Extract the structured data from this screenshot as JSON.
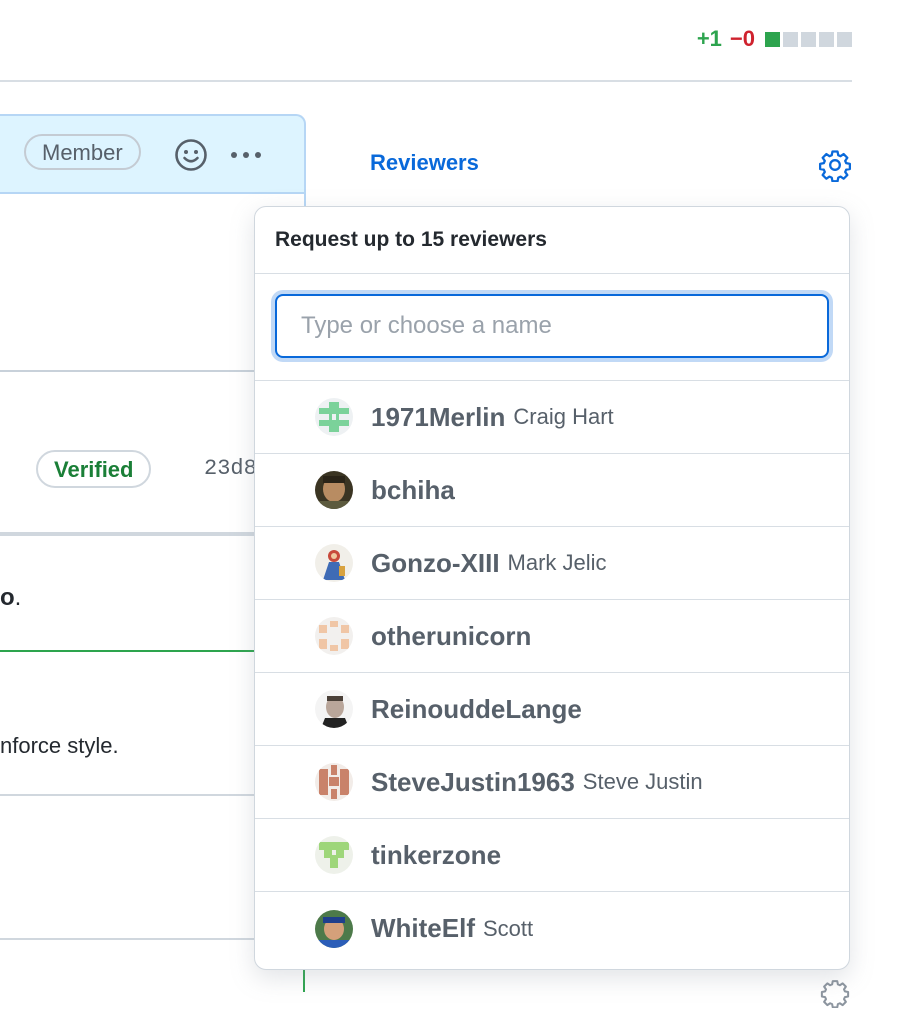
{
  "diffstat": {
    "additions": "+1",
    "deletions": "−0"
  },
  "comment": {
    "role_badge": "Member",
    "smiley_icon": "smiley-icon",
    "more_icon": "kebab-horizontal-icon"
  },
  "commit": {
    "verified_label": "Verified",
    "sha_fragment": "23d8"
  },
  "body_fragments": {
    "bold_fragment": "o",
    "period": ".",
    "enforce_text": "nforce style."
  },
  "sidebar": {
    "reviewers_label": "Reviewers",
    "gear_icon": "gear-icon"
  },
  "dropdown": {
    "header": "Request up to 15 reviewers",
    "filter_placeholder": "Type or choose a name",
    "items": [
      {
        "login": "1971Merlin",
        "name": "Craig Hart",
        "avatar": "identicon-green"
      },
      {
        "login": "bchiha",
        "name": "",
        "avatar": "photo"
      },
      {
        "login": "Gonzo-XIII",
        "name": "Mark Jelic",
        "avatar": "illustration"
      },
      {
        "login": "otherunicorn",
        "name": "",
        "avatar": "identicon-peach"
      },
      {
        "login": "ReinouddeLange",
        "name": "",
        "avatar": "photo"
      },
      {
        "login": "SteveJustin1963",
        "name": "Steve Justin",
        "avatar": "identicon-brown"
      },
      {
        "login": "tinkerzone",
        "name": "",
        "avatar": "identicon-lime"
      },
      {
        "login": "WhiteElf",
        "name": "Scott",
        "avatar": "photo"
      }
    ]
  },
  "colors": {
    "link": "#0969da",
    "added": "#2da44e",
    "deleted": "#cf222e",
    "verified": "#1a7f37"
  }
}
